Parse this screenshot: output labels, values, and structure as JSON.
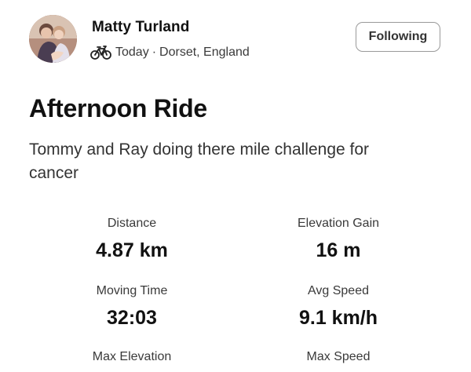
{
  "athlete": {
    "name": "Matty Turland",
    "avatar_icon": "avatar-photo"
  },
  "activity": {
    "type_icon": "bike-icon",
    "date": "Today",
    "separator": "·",
    "location": "Dorset, England",
    "title": "Afternoon Ride",
    "description": "Tommy and Ray doing there mile challenge for cancer"
  },
  "follow_button": {
    "label": "Following"
  },
  "stats": [
    {
      "label": "Distance",
      "value": "4.87 km"
    },
    {
      "label": "Elevation Gain",
      "value": "16 m"
    },
    {
      "label": "Moving Time",
      "value": "32:03"
    },
    {
      "label": "Avg Speed",
      "value": "9.1 km/h"
    },
    {
      "label": "Max Elevation",
      "value": ""
    },
    {
      "label": "Max Speed",
      "value": ""
    }
  ],
  "colors": {
    "text_primary": "#111111",
    "text_secondary": "#3a3a3a",
    "button_border": "#9a9a9a",
    "background": "#ffffff"
  }
}
